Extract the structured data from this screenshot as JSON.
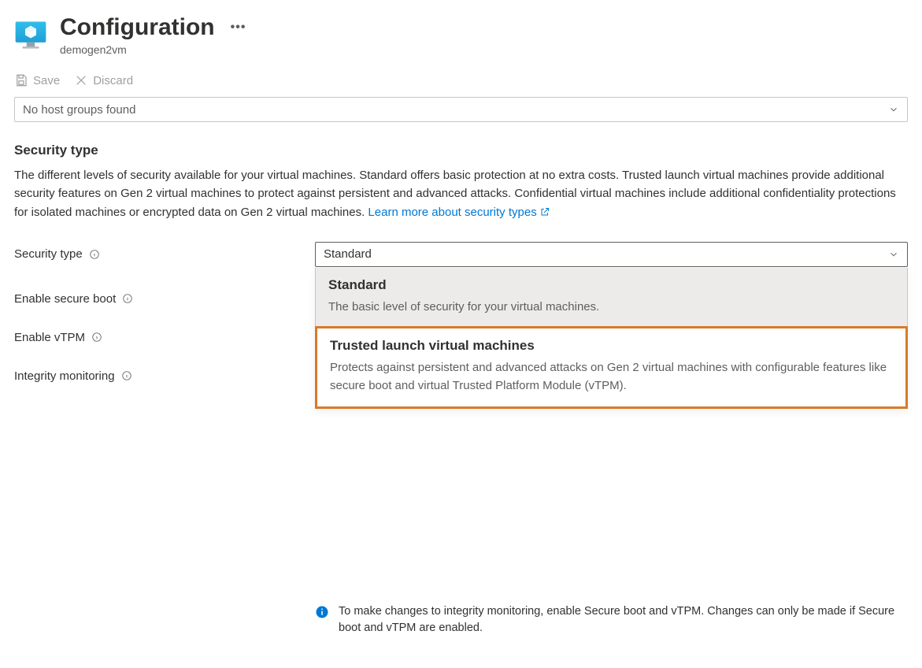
{
  "header": {
    "title": "Configuration",
    "resource_name": "demogen2vm"
  },
  "toolbar": {
    "save_label": "Save",
    "discard_label": "Discard"
  },
  "host_group": {
    "placeholder": "No host groups found"
  },
  "security": {
    "section_title": "Security type",
    "description": "The different levels of security available for your virtual machines. Standard offers basic protection at no extra costs. Trusted launch virtual machines provide additional security features on Gen 2 virtual machines to protect against persistent and advanced attacks. Confidential virtual machines include additional confidentiality protections for isolated machines or encrypted data on Gen 2 virtual machines.",
    "learn_more_label": "Learn more about security types",
    "fields": {
      "security_type_label": "Security type",
      "secure_boot_label": "Enable secure boot",
      "vtpm_label": "Enable vTPM",
      "integrity_label": "Integrity monitoring"
    },
    "selected_value": "Standard",
    "options": [
      {
        "title": "Standard",
        "desc": "The basic level of security for your virtual machines."
      },
      {
        "title": "Trusted launch virtual machines",
        "desc": "Protects against persistent and advanced attacks on Gen 2 virtual machines with configurable features like secure boot and virtual Trusted Platform Module (vTPM)."
      }
    ],
    "integrity_info": "To make changes to integrity monitoring, enable Secure boot and vTPM. Changes can only be made if Secure boot and vTPM are enabled."
  }
}
